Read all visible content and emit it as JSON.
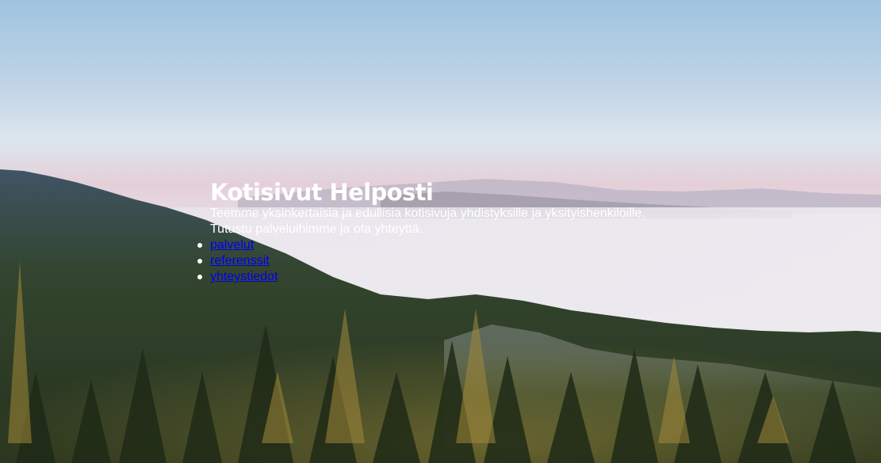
{
  "hero": {
    "title": "Kotisivut Helposti",
    "lines": [
      "Teemme yksinkertaisia ja edullisia kotisivuja yhdistyksille ja yksityishenkilöille.",
      "Tutustu palveluihimme ja ota yhteyttä."
    ]
  },
  "nav": {
    "items": [
      {
        "label": "palvelut"
      },
      {
        "label": "referenssit"
      },
      {
        "label": "yhteystiedot"
      }
    ]
  },
  "colors": {
    "sky_top": "#9fc3df",
    "sky_mid": "#dde6ee",
    "horizon": "#e4cfd8",
    "fog": "#e8e6ee",
    "forest_dark": "#2c3a24",
    "forest_gold": "#a8923a",
    "text": "#ffffff",
    "link": "#0000ee"
  },
  "icons": {
    "bullet": "disc-bullet-icon"
  }
}
